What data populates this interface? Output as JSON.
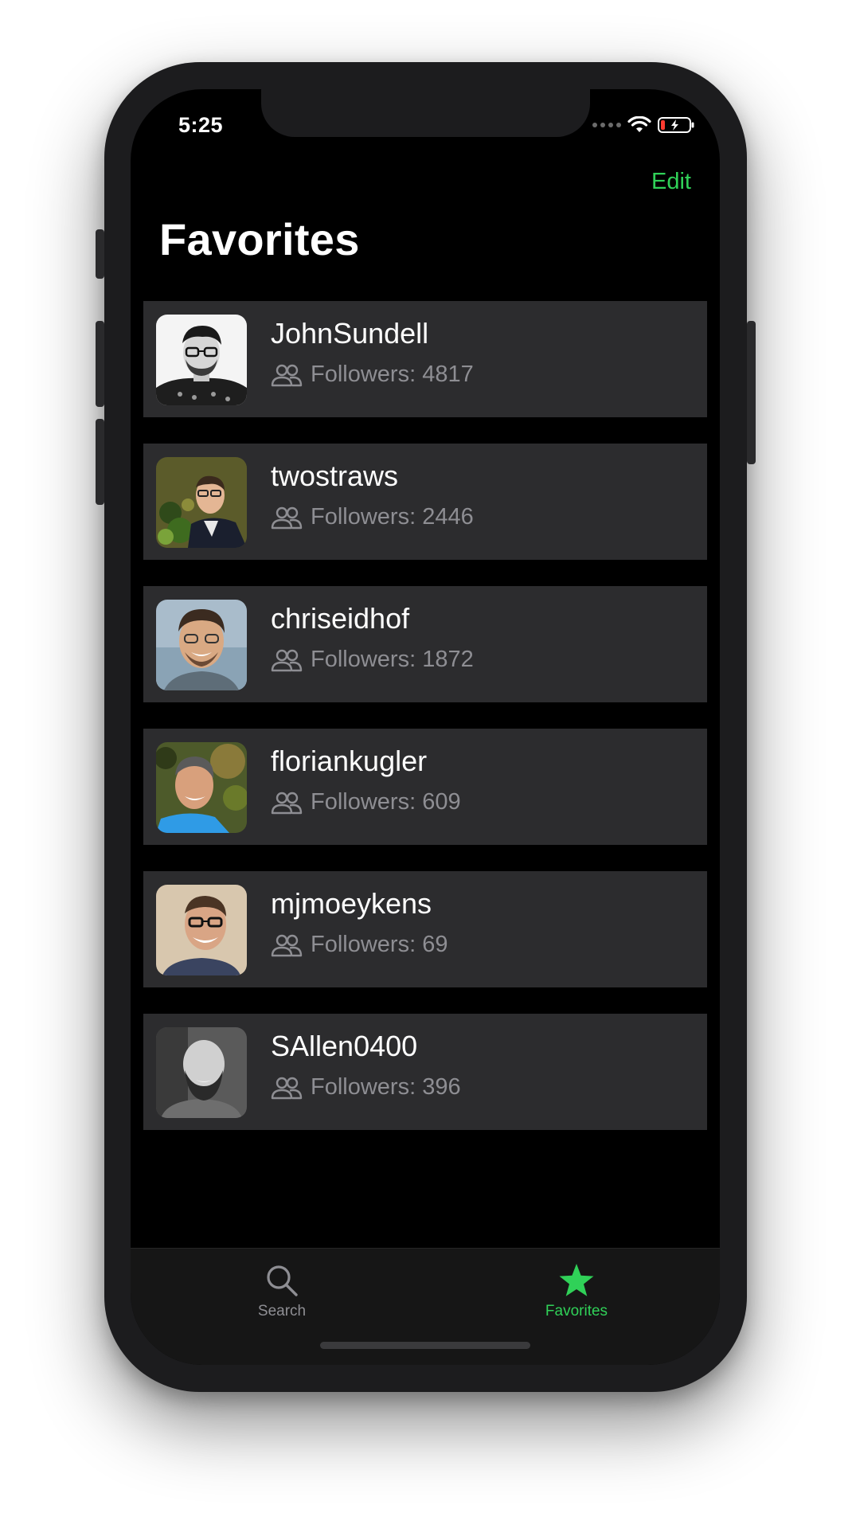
{
  "status_bar": {
    "time": "5:25"
  },
  "nav": {
    "edit_label": "Edit",
    "title": "Favorites"
  },
  "favorites": [
    {
      "username": "JohnSundell",
      "followers": "Followers: 4817"
    },
    {
      "username": "twostraws",
      "followers": "Followers: 2446"
    },
    {
      "username": "chriseidhof",
      "followers": "Followers: 1872"
    },
    {
      "username": "floriankugler",
      "followers": "Followers: 609"
    },
    {
      "username": "mjmoeykens",
      "followers": "Followers: 69"
    },
    {
      "username": "SAllen0400",
      "followers": "Followers: 396"
    }
  ],
  "tabs": [
    {
      "label": "Search",
      "icon": "magnifying-glass-icon",
      "active": false
    },
    {
      "label": "Favorites",
      "icon": "star-icon",
      "active": true
    }
  ],
  "colors": {
    "accent": "#30d158",
    "background": "#000000",
    "cell": "#2c2c2e",
    "secondary_text": "#8e8e93",
    "inactive_tab": "#8e8e93"
  }
}
